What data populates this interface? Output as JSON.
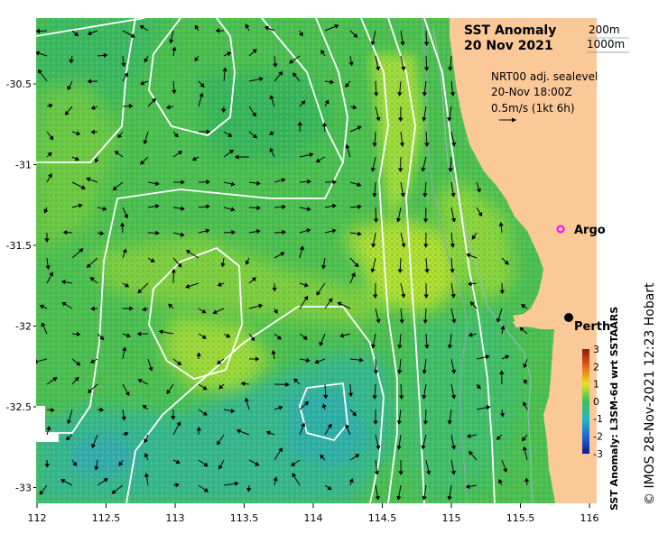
{
  "title": {
    "line1": "SST Anomaly",
    "line2": "20 Nov 2021"
  },
  "contour_legend": {
    "shallow": "200m",
    "deep": "1000m"
  },
  "vector_legend": {
    "line1": "NRT00 adj. sealevel",
    "line2": "20-Nov 18:00Z",
    "line3": "0.5m/s (1kt 6h)"
  },
  "places": [
    {
      "name": "Argo",
      "lon": 115.8,
      "lat": -31.45,
      "marker": "magenta-ring"
    },
    {
      "name": "Perth",
      "lon": 115.86,
      "lat": -31.95,
      "marker": "black-dot"
    }
  ],
  "axes": {
    "x_ticks": [
      "112",
      "112.5",
      "113",
      "113.5",
      "114",
      "114.5",
      "115",
      "115.5",
      "116"
    ],
    "y_ticks": [
      "-30.5",
      "-31",
      "-31.5",
      "-32",
      "-32.5",
      "-33"
    ]
  },
  "colorbar": {
    "label": "SST Anomaly: L3SM-6d wrt SSTAARS",
    "ticks": [
      "3",
      "2",
      "1",
      "0",
      "-1",
      "-2",
      "-3"
    ],
    "range": [
      -3,
      3
    ]
  },
  "credit": "© IMOS 28-Nov-2021 12:23 Hobart",
  "colors": {
    "land": "#fbc998",
    "sea_anomaly_base": "#4cbd52",
    "contours": "#ffffff",
    "shelf_contour": "#9eb8c8",
    "argo": "#ff00ff"
  }
}
